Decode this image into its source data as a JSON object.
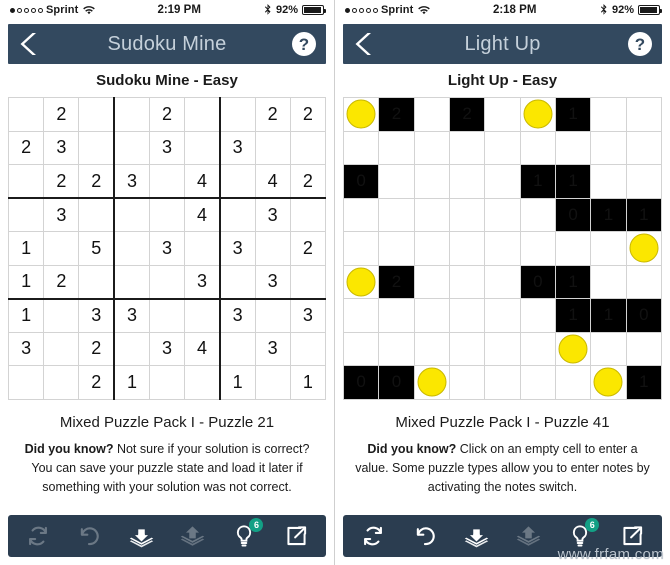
{
  "panels": [
    {
      "status": {
        "carrier": "Sprint",
        "signal_filled": 1,
        "signal_total": 5,
        "time": "2:19 PM",
        "battery_pct": "92%",
        "bluetooth_icon": "bluetooth-icon",
        "wifi_icon": "wifi-icon"
      },
      "nav": {
        "back_icon": "back-chevron-icon",
        "title": "Sudoku Mine",
        "help_label": "?"
      },
      "subtitle": "Sudoku Mine - Easy",
      "grid": {
        "type": "sudoku",
        "rows": 9,
        "cols": 9,
        "cells": [
          [
            "",
            "2",
            "",
            "",
            "2",
            "",
            "",
            "2",
            "2"
          ],
          [
            "2",
            "3",
            "",
            "",
            "3",
            "",
            "3",
            "",
            ""
          ],
          [
            "",
            "2",
            "2",
            "3",
            "",
            "4",
            "",
            "4",
            "2"
          ],
          [
            "",
            "3",
            "",
            "",
            "",
            "4",
            "",
            "3",
            ""
          ],
          [
            "1",
            "",
            "5",
            "",
            "3",
            "",
            "3",
            "",
            "2"
          ],
          [
            "1",
            "2",
            "",
            "",
            "",
            "3",
            "",
            "3",
            ""
          ],
          [
            "1",
            "",
            "3",
            "3",
            "",
            "",
            "3",
            "",
            "3"
          ],
          [
            "3",
            "",
            "2",
            "",
            "3",
            "4",
            "",
            "3",
            ""
          ],
          [
            "",
            "",
            "2",
            "1",
            "",
            "",
            "1",
            "",
            "1"
          ]
        ]
      },
      "info": {
        "pack": "Mixed Puzzle Pack I - Puzzle 21",
        "tip_label": "Did you know?",
        "tip_text": " Not sure if your solution is correct? You can save your puzzle state and load it later if something with your solution was not correct."
      },
      "toolbar": [
        {
          "name": "refresh-button",
          "icon": "refresh-icon",
          "enabled": false,
          "badge": ""
        },
        {
          "name": "undo-button",
          "icon": "undo-icon",
          "enabled": false,
          "badge": ""
        },
        {
          "name": "save-button",
          "icon": "download-icon",
          "enabled": true,
          "badge": ""
        },
        {
          "name": "load-button",
          "icon": "upload-icon",
          "enabled": false,
          "badge": ""
        },
        {
          "name": "hint-button",
          "icon": "lightbulb-icon",
          "enabled": true,
          "badge": "6"
        },
        {
          "name": "share-button",
          "icon": "share-icon",
          "enabled": true,
          "badge": ""
        }
      ]
    },
    {
      "status": {
        "carrier": "Sprint",
        "signal_filled": 1,
        "signal_total": 5,
        "time": "2:18 PM",
        "battery_pct": "92%",
        "bluetooth_icon": "bluetooth-icon",
        "wifi_icon": "wifi-icon"
      },
      "nav": {
        "back_icon": "back-chevron-icon",
        "title": "Light Up",
        "help_label": "?"
      },
      "subtitle": "Light Up - Easy",
      "grid": {
        "type": "lightup",
        "rows": 9,
        "cols": 9,
        "cells": [
          [
            {
              "t": "bulb"
            },
            {
              "t": "black",
              "v": "2"
            },
            {
              "t": "empty"
            },
            {
              "t": "black",
              "v": "2"
            },
            {
              "t": "empty"
            },
            {
              "t": "bulb"
            },
            {
              "t": "black",
              "v": "1"
            },
            {
              "t": "empty"
            },
            {
              "t": "empty"
            }
          ],
          [
            {
              "t": "empty"
            },
            {
              "t": "empty"
            },
            {
              "t": "empty"
            },
            {
              "t": "empty"
            },
            {
              "t": "empty"
            },
            {
              "t": "empty"
            },
            {
              "t": "empty"
            },
            {
              "t": "empty"
            },
            {
              "t": "empty"
            }
          ],
          [
            {
              "t": "black",
              "v": "0"
            },
            {
              "t": "empty"
            },
            {
              "t": "empty"
            },
            {
              "t": "empty"
            },
            {
              "t": "empty"
            },
            {
              "t": "black",
              "v": "1"
            },
            {
              "t": "black",
              "v": "1"
            },
            {
              "t": "empty"
            },
            {
              "t": "empty"
            }
          ],
          [
            {
              "t": "empty"
            },
            {
              "t": "empty"
            },
            {
              "t": "empty"
            },
            {
              "t": "empty"
            },
            {
              "t": "empty"
            },
            {
              "t": "empty"
            },
            {
              "t": "black",
              "v": "0"
            },
            {
              "t": "black",
              "v": "1"
            },
            {
              "t": "black",
              "v": "1"
            }
          ],
          [
            {
              "t": "empty"
            },
            {
              "t": "empty"
            },
            {
              "t": "empty"
            },
            {
              "t": "empty"
            },
            {
              "t": "empty"
            },
            {
              "t": "empty"
            },
            {
              "t": "empty"
            },
            {
              "t": "empty"
            },
            {
              "t": "bulb"
            }
          ],
          [
            {
              "t": "bulb"
            },
            {
              "t": "black",
              "v": "2"
            },
            {
              "t": "empty"
            },
            {
              "t": "empty"
            },
            {
              "t": "empty"
            },
            {
              "t": "black",
              "v": "0"
            },
            {
              "t": "black",
              "v": "1"
            },
            {
              "t": "empty"
            },
            {
              "t": "empty"
            }
          ],
          [
            {
              "t": "empty"
            },
            {
              "t": "empty"
            },
            {
              "t": "empty"
            },
            {
              "t": "empty"
            },
            {
              "t": "empty"
            },
            {
              "t": "empty"
            },
            {
              "t": "black",
              "v": "1"
            },
            {
              "t": "black",
              "v": "1"
            },
            {
              "t": "black",
              "v": "0"
            }
          ],
          [
            {
              "t": "empty"
            },
            {
              "t": "empty"
            },
            {
              "t": "empty"
            },
            {
              "t": "empty"
            },
            {
              "t": "empty"
            },
            {
              "t": "empty"
            },
            {
              "t": "bulb"
            },
            {
              "t": "empty"
            },
            {
              "t": "empty"
            }
          ],
          [
            {
              "t": "black",
              "v": "0"
            },
            {
              "t": "black",
              "v": "0"
            },
            {
              "t": "bulb"
            },
            {
              "t": "empty"
            },
            {
              "t": "empty"
            },
            {
              "t": "empty"
            },
            {
              "t": "empty"
            },
            {
              "t": "bulb"
            },
            {
              "t": "black",
              "v": "1"
            }
          ]
        ]
      },
      "info": {
        "pack": "Mixed Puzzle Pack I - Puzzle 41",
        "tip_label": "Did you know?",
        "tip_text": " Click on an empty cell to enter a value. Some puzzle types allow you to enter notes by activating the notes switch."
      },
      "toolbar": [
        {
          "name": "refresh-button",
          "icon": "refresh-icon",
          "enabled": true,
          "badge": ""
        },
        {
          "name": "undo-button",
          "icon": "undo-icon",
          "enabled": true,
          "badge": ""
        },
        {
          "name": "save-button",
          "icon": "download-icon",
          "enabled": true,
          "badge": ""
        },
        {
          "name": "load-button",
          "icon": "upload-icon",
          "enabled": false,
          "badge": ""
        },
        {
          "name": "hint-button",
          "icon": "lightbulb-icon",
          "enabled": true,
          "badge": "6"
        },
        {
          "name": "share-button",
          "icon": "share-icon",
          "enabled": true,
          "badge": ""
        }
      ]
    }
  ],
  "watermark": "www.frfam.com",
  "colors": {
    "nav_bg": "#33495f",
    "toolbar_bg": "#2b3d50",
    "nav_title": "#c5d0da",
    "badge": "#13a085",
    "bulb": "#fbe700",
    "black_cell": "#000000"
  }
}
